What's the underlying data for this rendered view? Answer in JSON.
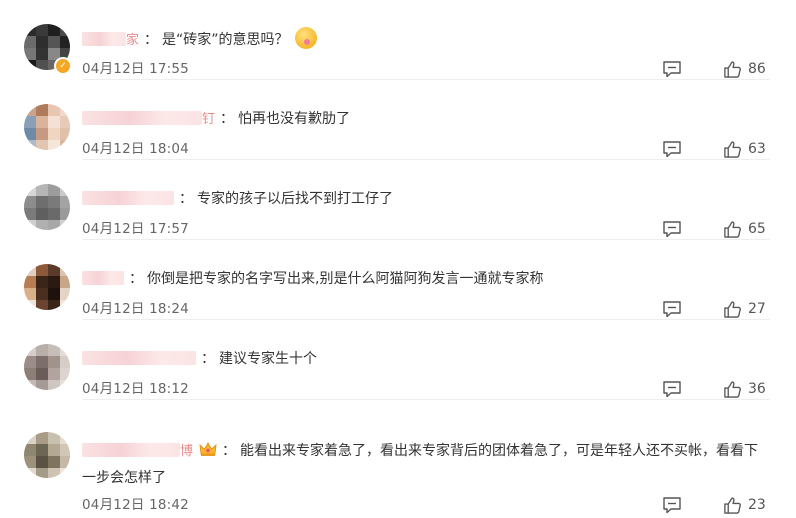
{
  "comments": [
    {
      "name_tail": "家",
      "text": "是“砖家”的意思吗？",
      "has_emoji": true,
      "date": "04月12日",
      "time": "17:55",
      "likes": "86",
      "avatar_colors": [
        "#2b2b2b",
        "#3a3a3a",
        "#1f1f1f",
        "#4a4a4a",
        "#6b6b6b",
        "#2e2e2e",
        "#555555",
        "#222222",
        "#777777",
        "#333333",
        "#888888",
        "#444444",
        "#1a1a1a",
        "#505050",
        "#666666",
        "#2a2a2a"
      ]
    },
    {
      "name_tail": "钉",
      "text": "怕再也没有歉肋了",
      "date": "04月12日",
      "time": "18:04",
      "likes": "63",
      "avatar_colors": [
        "#c9a48a",
        "#b07a5c",
        "#e8c7b2",
        "#f1d8c8",
        "#8aa0b8",
        "#d9b49a",
        "#f4e0d4",
        "#e6cbb8",
        "#6d8aa6",
        "#c69a80",
        "#efd5c2",
        "#dfc0aa",
        "#a9b9c9",
        "#e2c5b0",
        "#f6e6da",
        "#d8b8a0"
      ]
    },
    {
      "name_tail": "",
      "text": "专家的孩子以后找不到打工仔了",
      "date": "04月12日",
      "time": "17:57",
      "likes": "65",
      "avatar_colors": [
        "#d6d6d6",
        "#b5b5b5",
        "#9c9c9c",
        "#c9c9c9",
        "#8d8d8d",
        "#6e6e6e",
        "#7a7a7a",
        "#a3a3a3",
        "#7b7b7b",
        "#5f5f5f",
        "#6a6a6a",
        "#9a9a9a",
        "#cfcfcf",
        "#b0b0b0",
        "#a8a8a8",
        "#d2d2d2"
      ]
    },
    {
      "name_tail": "",
      "text": "你倒是把专家的名字写出来,别是什么阿猫阿狗发言一通就专家称",
      "date": "04月12日",
      "time": "18:24",
      "likes": "27",
      "avatar_colors": [
        "#e0cfc0",
        "#8c5a3a",
        "#5a3a28",
        "#d9c4b2",
        "#b77d55",
        "#3b2418",
        "#2a1a12",
        "#c9a688",
        "#d8b08a",
        "#4a2e20",
        "#1e120c",
        "#e4d4c6",
        "#efe4da",
        "#6a4430",
        "#3a2418",
        "#f0e6dc"
      ]
    },
    {
      "name_tail": "",
      "text": "建议专家生十个",
      "date": "04月12日",
      "time": "18:12",
      "likes": "36",
      "avatar_colors": [
        "#d4cfcc",
        "#b8aeaa",
        "#c7bdb8",
        "#e2dcd8",
        "#9a8d88",
        "#7c6e6a",
        "#a2928c",
        "#d6ccc8",
        "#8e7e78",
        "#6a5c58",
        "#b3a39e",
        "#ddd4d0",
        "#c2b8b4",
        "#a69a96",
        "#cfc6c2",
        "#e6e0dc"
      ]
    },
    {
      "name_tail": "博",
      "text": "能看出来专家着急了，看出来专家背后的团体着急了，可是年轻人还不买帐，看看下一步会怎样了",
      "has_crown": true,
      "date": "04月12日",
      "time": "18:42",
      "likes": "23",
      "avatar_colors": [
        "#d9d2c6",
        "#a89c88",
        "#c9bfae",
        "#e4ddd2",
        "#8f8672",
        "#6e6654",
        "#b3a892",
        "#d0c7b6",
        "#9c927c",
        "#5a5242",
        "#7e7460",
        "#c4b9a6",
        "#e0d8cc",
        "#a69b86",
        "#cfc4b2",
        "#ebe5dc"
      ]
    }
  ],
  "colon": "：",
  "colors": {
    "text": "#333333",
    "meta": "#666666",
    "divider": "#eeeeee",
    "icon": "#555555",
    "blur": "#f6d2d6"
  }
}
